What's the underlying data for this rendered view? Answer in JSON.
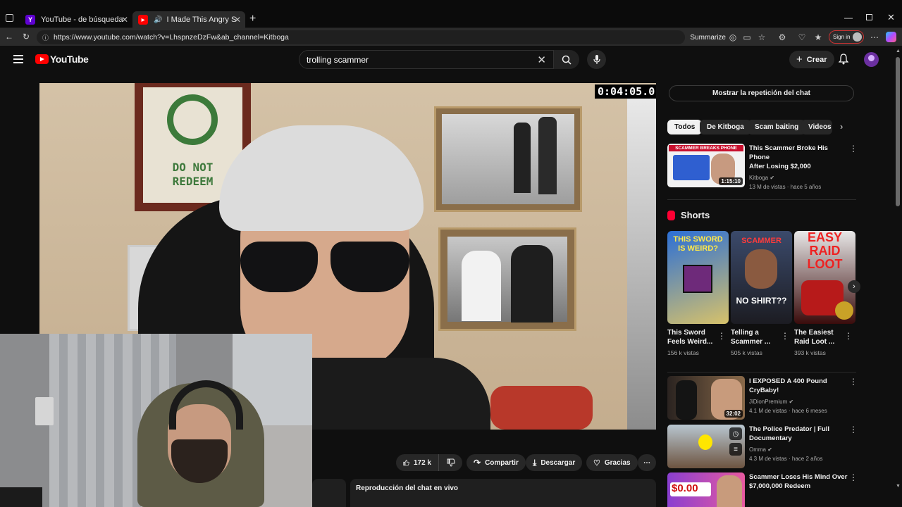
{
  "browser": {
    "tabs": [
      {
        "title": "YouTube - de búsqueda",
        "favicon": "Y"
      },
      {
        "title": "I Made This Angry Scammer",
        "favicon": "▶"
      }
    ],
    "url": "https://www.youtube.com/watch?v=LhspnzeDzFw&ab_channel=Kitboga",
    "summarize_label": "Summarize",
    "signin_label": "Sign in"
  },
  "header": {
    "logo_text": "YouTube",
    "search_value": "trolling scammer",
    "create_label": "Crear"
  },
  "video": {
    "timestamp": "0:04:05.0",
    "sign_text_line1": "DO NOT",
    "sign_text_line2": "REDEEM"
  },
  "actions": {
    "likes": "172 k",
    "share_label": "Compartir",
    "download_label": "Descargar",
    "thanks_label": "Gracias"
  },
  "chat_replay_bottom": "Reproducción del chat en vivo",
  "sidebar": {
    "chat_replay_button": "Mostrar la repetición del chat",
    "chips": [
      "Todos",
      "De Kitboga",
      "Scam baiting",
      "Videos r"
    ],
    "top_video": {
      "title_line1": "This Scammer Broke His Phone",
      "title_line2": "After Losing $2,000",
      "channel": "Kitboga",
      "meta": "13 M de vistas · hace 5 años",
      "duration": "1:15:10",
      "thumb_caption": "SCAMMER BREAKS PHONE"
    },
    "shorts_heading": "Shorts",
    "shorts": [
      {
        "title_line1": "This Sword",
        "title_line2": "Feels Weird...",
        "views": "156 k vistas",
        "thumb_text": "THIS SWORD IS WEIRD?"
      },
      {
        "title_line1": "Telling a",
        "title_line2": "Scammer ...",
        "views": "505 k vistas",
        "thumb_text": "NO SHIRT??",
        "thumb_top": "SCAMMER"
      },
      {
        "title_line1": "The Easiest",
        "title_line2": "Raid Loot ...",
        "views": "393 k vistas",
        "thumb_text": "EASY RAID LOOT"
      }
    ],
    "videos": [
      {
        "title_line1": "I EXPOSED A 400 Pound",
        "title_line2": "CryBaby!",
        "channel": "JiDionPremium",
        "meta": "4.1 M de vistas · hace 6 meses",
        "duration": "32:02"
      },
      {
        "title_line1": "The Police Predator | Full",
        "title_line2": "Documentary",
        "channel": "Omma",
        "meta": "4.3 M de vistas · hace 2 años"
      },
      {
        "title_line1": "Scammer Loses His Mind Over",
        "title_line2": "$7,000,000 Redeem",
        "thumb_text": "$0.00"
      }
    ]
  },
  "colors": {
    "youtube_red": "#ff0000",
    "bg": "#0f0f0f",
    "chip_bg": "#272727"
  }
}
